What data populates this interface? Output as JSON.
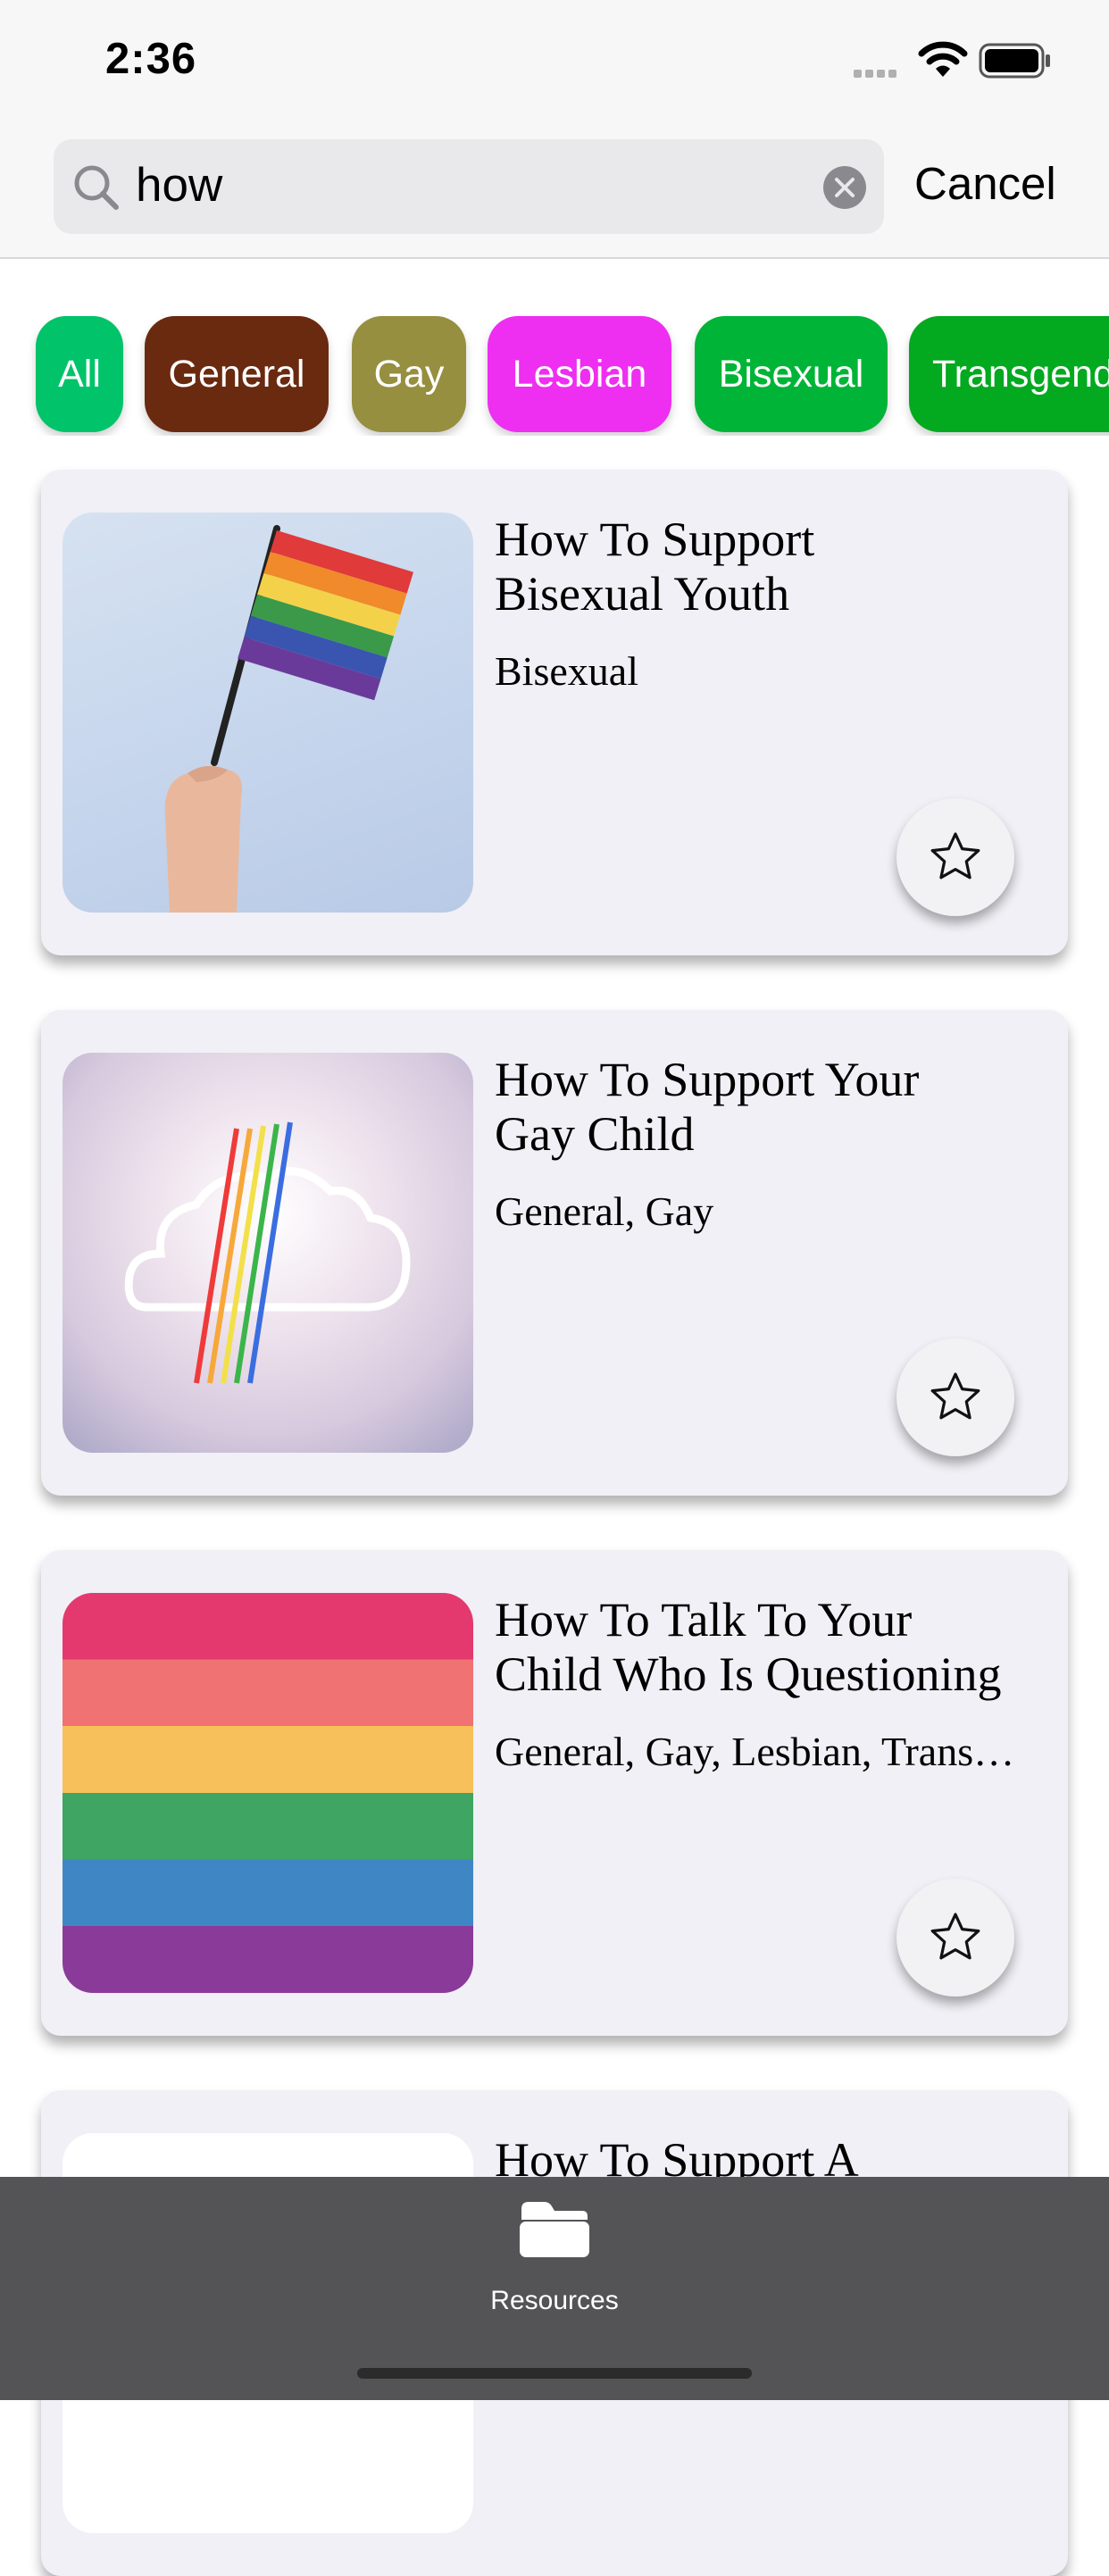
{
  "status_bar": {
    "time": "2:36",
    "icons": [
      "cellular-signal-icon",
      "wifi-icon",
      "battery-icon"
    ]
  },
  "search": {
    "value": "how",
    "cancel_label": "Cancel"
  },
  "filters": [
    {
      "label": "All",
      "color": "#00c36a"
    },
    {
      "label": "General",
      "color": "#6a2a10"
    },
    {
      "label": "Gay",
      "color": "#958f3f"
    },
    {
      "label": "Lesbian",
      "color": "#ee2ef0"
    },
    {
      "label": "Bisexual",
      "color": "#00b437"
    },
    {
      "label": "Transgender",
      "color": "#03a91f"
    }
  ],
  "resources": [
    {
      "title_line1": "How To Support",
      "title_line2": "Bisexual Youth",
      "categories": "Bisexual",
      "image": "rainbow-flag-in-hand"
    },
    {
      "title_line1": "How To Support Your",
      "title_line2": "Gay Child",
      "categories": "General, Gay",
      "image": "neon-rainbow-cloud"
    },
    {
      "title_line1": "How To Talk To Your",
      "title_line2": "Child Who Is Questioning",
      "categories": "General, Gay, Lesbian, Transgender",
      "image": "rainbow-stripes"
    },
    {
      "title_line1": "How To Support A",
      "title_line2": "",
      "categories": "",
      "image": "white"
    }
  ],
  "tab_bar": {
    "items": [
      {
        "label": "Resources",
        "icon": "folder-icon"
      }
    ]
  },
  "colors": {
    "tab_bar_bg": "#545456",
    "card_bg": "#f1f0f6",
    "header_bg": "#f7f7f7"
  }
}
